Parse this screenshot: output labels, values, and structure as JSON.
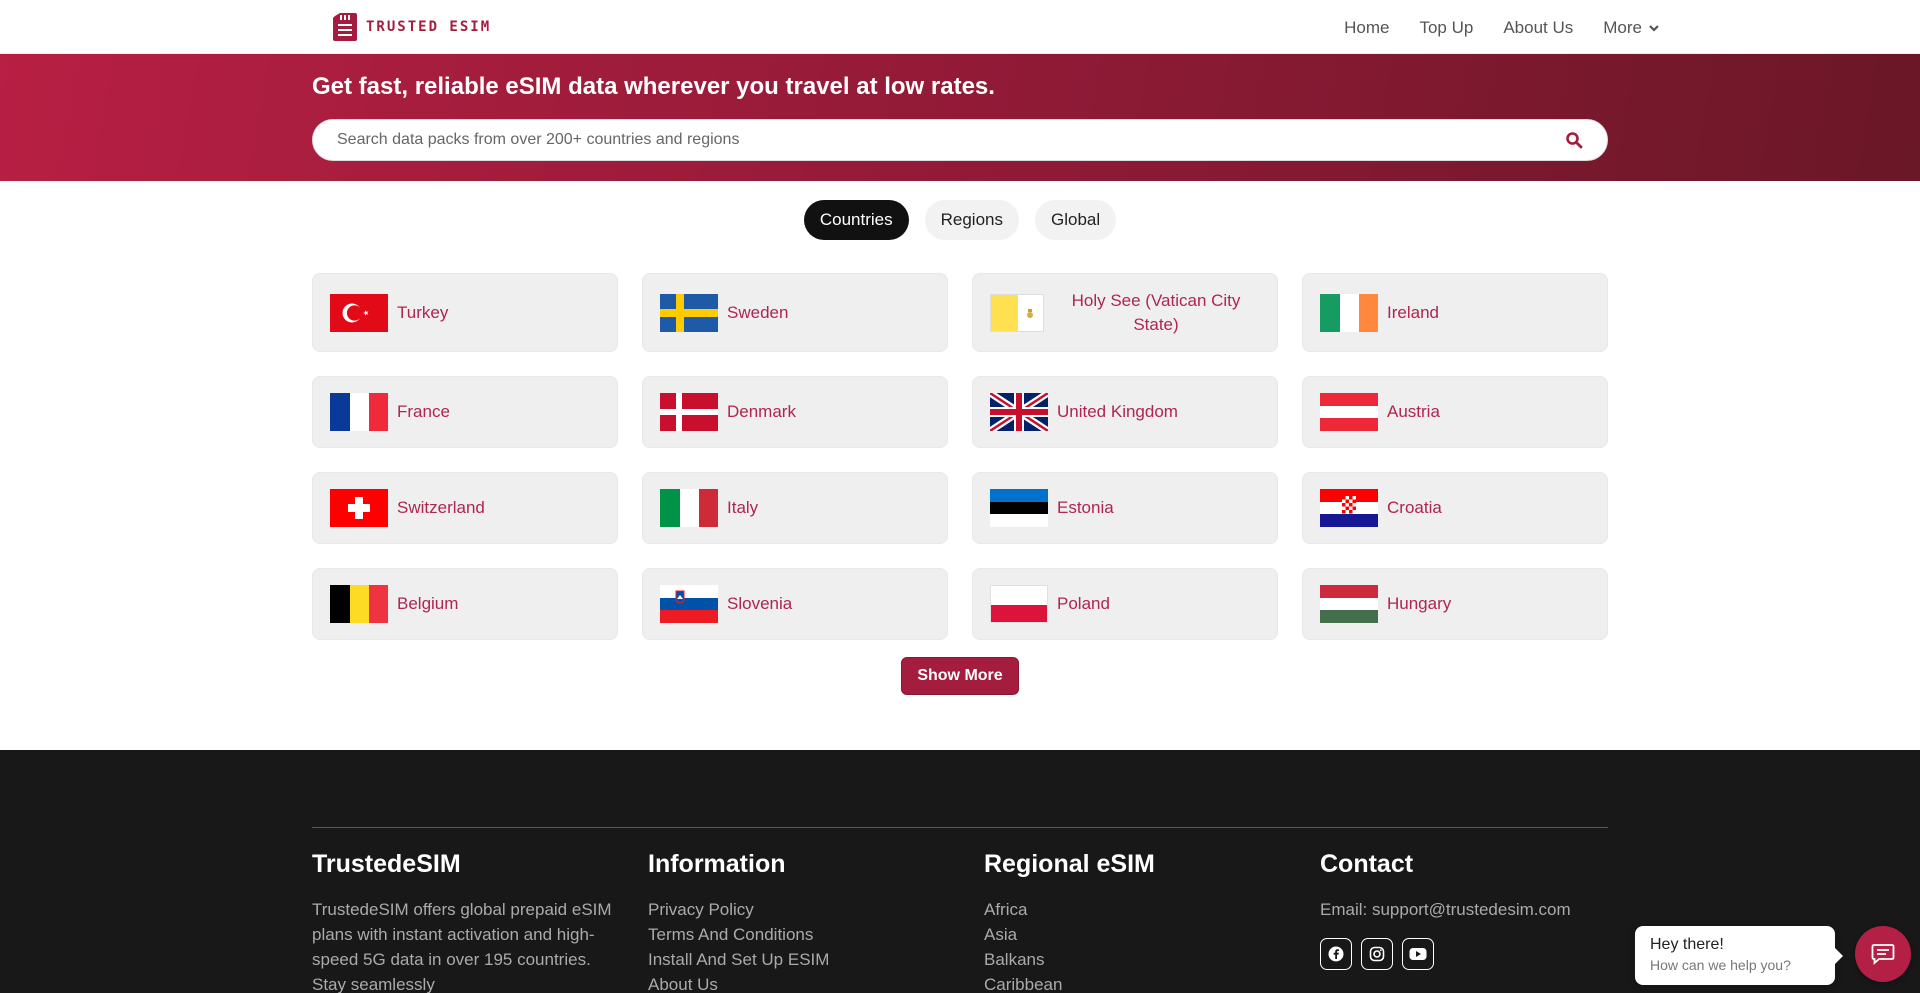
{
  "brand": {
    "name": "TRUSTED ESIM",
    "color": "#a51d3e"
  },
  "nav": {
    "items": [
      "Home",
      "Top Up",
      "About Us",
      "More"
    ]
  },
  "hero": {
    "title": "Get fast, reliable eSIM data wherever you travel at low rates.",
    "search_placeholder": "Search data packs from over 200+ countries and regions"
  },
  "tabs": [
    {
      "label": "Countries",
      "active": true
    },
    {
      "label": "Regions",
      "active": false
    },
    {
      "label": "Global",
      "active": false
    }
  ],
  "countries": [
    {
      "name": "Turkey",
      "flag": "turkey-flag"
    },
    {
      "name": "Sweden",
      "flag": "sweden-flag"
    },
    {
      "name": "Holy See (Vatican City State)",
      "flag": "vatican-flag"
    },
    {
      "name": "Ireland",
      "flag": "ireland-flag"
    },
    {
      "name": "France",
      "flag": "france-flag"
    },
    {
      "name": "Denmark",
      "flag": "denmark-flag"
    },
    {
      "name": "United Kingdom",
      "flag": "uk-flag"
    },
    {
      "name": "Austria",
      "flag": "austria-flag"
    },
    {
      "name": "Switzerland",
      "flag": "switzerland-flag"
    },
    {
      "name": "Italy",
      "flag": "italy-flag"
    },
    {
      "name": "Estonia",
      "flag": "estonia-flag"
    },
    {
      "name": "Croatia",
      "flag": "croatia-flag"
    },
    {
      "name": "Belgium",
      "flag": "belgium-flag"
    },
    {
      "name": "Slovenia",
      "flag": "slovenia-flag"
    },
    {
      "name": "Poland",
      "flag": "poland-flag"
    },
    {
      "name": "Hungary",
      "flag": "hungary-flag"
    }
  ],
  "show_more_label": "Show More",
  "footer": {
    "about": {
      "title": "TrustedeSIM",
      "text": "TrustedeSIM offers global prepaid eSIM plans with instant activation and high-speed 5G data in over 195 countries. Stay seamlessly"
    },
    "information": {
      "title": "Information",
      "links": [
        "Privacy Policy",
        "Terms And Conditions",
        "Install And Set Up ESIM",
        "About Us"
      ]
    },
    "regional": {
      "title": "Regional eSIM",
      "links": [
        "Africa",
        "Asia",
        "Balkans",
        "Caribbean"
      ]
    },
    "contact": {
      "title": "Contact",
      "email": "Email: support@trustedesim.com",
      "socials": [
        "facebook-icon",
        "instagram-icon",
        "youtube-icon"
      ]
    }
  },
  "chat": {
    "title": "Hey there!",
    "subtitle": "How can we help you?"
  }
}
